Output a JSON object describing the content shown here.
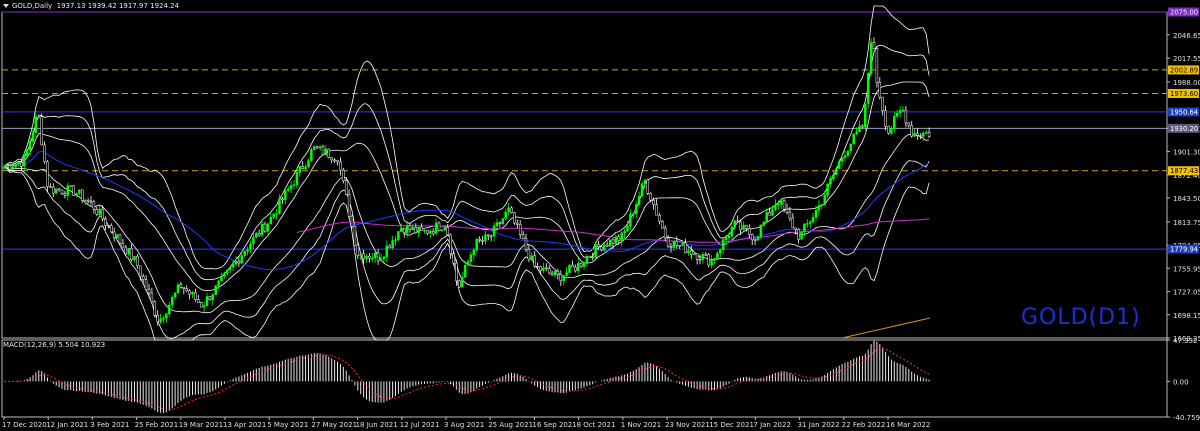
{
  "symbol_label": "GOLD,Daily",
  "ohlc_text": "1937.13 1939.42 1917.97 1924.24",
  "watermark": "GOLD(D1)",
  "macd_label": "MACD(12,26,9) 5.504 10.923",
  "colors": {
    "background": "#000000",
    "candle_up": "#00ff00",
    "candle_down": "#ffffff",
    "bands": "#ffffff",
    "ma_blue": "#1d3cff",
    "ma_magenta": "#cc2fcc",
    "ma_orange": "#d98f1e",
    "level_gold": "#d4a017",
    "level_blue": "#2b3cff",
    "level_purple": "#7b2fbf",
    "macd_signal": "#ff2a2a",
    "watermark": "#1f2fd8"
  },
  "chart_data": {
    "type": "candlestick",
    "title": "GOLD,Daily",
    "ylim": [
      1669.25,
      2075.0
    ],
    "y_ticks": [
      "2046.65",
      "2017.55",
      "1988.00",
      "1930.20",
      "1901.30",
      "1872.40",
      "1843.50",
      "1813.75",
      "1784.85",
      "1755.95",
      "1727.05",
      "1698.15",
      "1669.25"
    ],
    "x_ticks": [
      "17 Dec 2020",
      "12 Jan 2021",
      "3 Feb 2021",
      "25 Feb 2021",
      "19 Mar 2021",
      "13 Apr 2021",
      "5 May 2021",
      "27 May 2021",
      "18 Jun 2021",
      "12 Jul 2021",
      "3 Aug 2021",
      "25 Aug 2021",
      "16 Sep 2021",
      "8 Oct 2021",
      "1 Nov 2021",
      "23 Nov 2021",
      "15 Dec 2021",
      "7 Jan 2022",
      "31 Jan 2022",
      "22 Feb 2022",
      "16 Mar 2022"
    ],
    "price_levels": [
      {
        "label": "2075.00",
        "value": 2075.0,
        "style": "purple"
      },
      {
        "label": "2002.89",
        "value": 2002.89,
        "style": "gold"
      },
      {
        "label": "1973.60",
        "value": 1973.6,
        "style": "gold"
      },
      {
        "label": "1950.64",
        "value": 1950.64,
        "style": "blue"
      },
      {
        "label": "1930.20",
        "value": 1930.2,
        "style": "current"
      },
      {
        "label": "1877.43",
        "value": 1877.43,
        "style": "gold"
      },
      {
        "label": "1779.94",
        "value": 1779.94,
        "style": "blue"
      }
    ],
    "price_path": [
      [
        "17 Dec 2020",
        1882
      ],
      [
        "29 Dec 2020",
        1890
      ],
      [
        "6 Jan 2021",
        1950
      ],
      [
        "12 Jan 2021",
        1855
      ],
      [
        "25 Jan 2021",
        1852
      ],
      [
        "3 Feb 2021",
        1835
      ],
      [
        "15 Feb 2021",
        1795
      ],
      [
        "25 Feb 2021",
        1762
      ],
      [
        "8 Mar 2021",
        1690
      ],
      [
        "19 Mar 2021",
        1735
      ],
      [
        "31 Mar 2021",
        1710
      ],
      [
        "13 Apr 2021",
        1745
      ],
      [
        "23 Apr 2021",
        1780
      ],
      [
        "5 May 2021",
        1815
      ],
      [
        "18 May 2021",
        1868
      ],
      [
        "27 May 2021",
        1905
      ],
      [
        "8 Jun 2021",
        1895
      ],
      [
        "18 Jun 2021",
        1775
      ],
      [
        "30 Jun 2021",
        1770
      ],
      [
        "12 Jul 2021",
        1808
      ],
      [
        "22 Jul 2021",
        1800
      ],
      [
        "3 Aug 2021",
        1812
      ],
      [
        "9 Aug 2021",
        1730
      ],
      [
        "17 Aug 2021",
        1785
      ],
      [
        "25 Aug 2021",
        1795
      ],
      [
        "3 Sep 2021",
        1828
      ],
      [
        "16 Sep 2021",
        1758
      ],
      [
        "28 Sep 2021",
        1745
      ],
      [
        "8 Oct 2021",
        1760
      ],
      [
        "20 Oct 2021",
        1785
      ],
      [
        "1 Nov 2021",
        1795
      ],
      [
        "12 Nov 2021",
        1865
      ],
      [
        "23 Nov 2021",
        1790
      ],
      [
        "3 Dec 2021",
        1780
      ],
      [
        "15 Dec 2021",
        1765
      ],
      [
        "27 Dec 2021",
        1810
      ],
      [
        "7 Jan 2022",
        1795
      ],
      [
        "19 Jan 2022",
        1842
      ],
      [
        "31 Jan 2022",
        1795
      ],
      [
        "10 Feb 2022",
        1835
      ],
      [
        "22 Feb 2022",
        1900
      ],
      [
        "4 Mar 2022",
        1935
      ],
      [
        "8 Mar 2022",
        2055
      ],
      [
        "10 Mar 2022",
        1995
      ],
      [
        "16 Mar 2022",
        1925
      ],
      [
        "23 Mar 2022",
        1955
      ],
      [
        "28 Mar 2022",
        1924
      ]
    ],
    "macd": {
      "label": "MACD(12,26,9)",
      "main": 5.504,
      "signal": 10.923,
      "ylim": [
        -40.759,
        47.332
      ],
      "y_ticks": [
        "47.332",
        "0.00",
        "-40.759"
      ]
    }
  }
}
